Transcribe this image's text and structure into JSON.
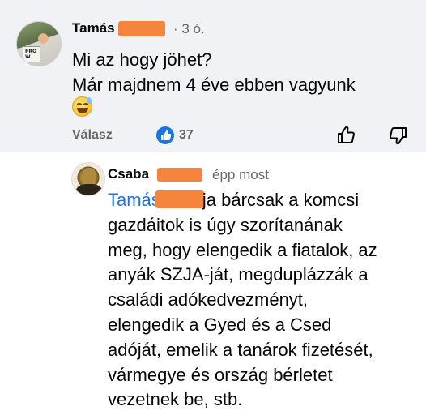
{
  "comment1": {
    "author": "Tamás",
    "author_redacted": "",
    "time": "· 3 ó.",
    "lines": [
      "Mi az hogy jöhet?",
      "Már majdnem 4 éve ebben vagyunk"
    ],
    "emoji": "sweat-smile-emoji",
    "reply_label": "Válasz",
    "like_count": "37",
    "like_color": "#1b74e4",
    "avatar_sign": "PRO W"
  },
  "comment2": {
    "author": "Csaba",
    "time": "épp most",
    "mention": "Tamás",
    "lines": [
      " ja bárcsak a komcsi",
      "gazdáitok is úgy szorítanának",
      "meg, hogy elengedik a fiatalok, az",
      "anyák SZJA-ját, megduplázzák a",
      "családi adókedvezményt,",
      "elengedik a Gyed és a Csed",
      "adóját, emelik a tanárok fizetését,",
      "vármegye és ország bérletet",
      "vezetnek be, stb."
    ]
  },
  "colors": {
    "comment1_bg": "#f0f2f5",
    "redaction": "#f5843d",
    "mention": "#1b74e4",
    "meta": "#65676b"
  }
}
